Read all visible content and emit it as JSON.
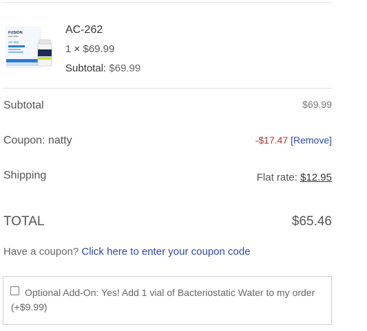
{
  "product": {
    "name": "AC-262",
    "qty": "1",
    "times": "×",
    "price": "$69.99",
    "subtotal_label": "Subtotal:",
    "subtotal_value": "$69.99",
    "image_icon": "product-box-icon",
    "image_brand_text": "FUSION",
    "image_brand_sub": "PEPTIDES",
    "image_product_text": "AC-262"
  },
  "totals": {
    "subtotal_label": "Subtotal",
    "subtotal_value": "$69.99",
    "coupon_label": "Coupon: natty",
    "coupon_value": "-$17.47",
    "remove_label": "[Remove]",
    "shipping_label": "Shipping",
    "shipping_method": "Flat rate:",
    "shipping_value": "$12.95",
    "total_label": "TOTAL",
    "total_value": "$65.46"
  },
  "coupon_prompt": {
    "text": "Have a coupon?",
    "link": "Click here to enter your coupon code"
  },
  "addon": {
    "checked": false,
    "label": "Optional Add-On: Yes! Add 1 vial of Bacteriostatic Water to my order (+$9.99)"
  },
  "colors": {
    "link": "#2e4aa8",
    "discount": "#b0382f",
    "rule": "#e2e2e2"
  }
}
